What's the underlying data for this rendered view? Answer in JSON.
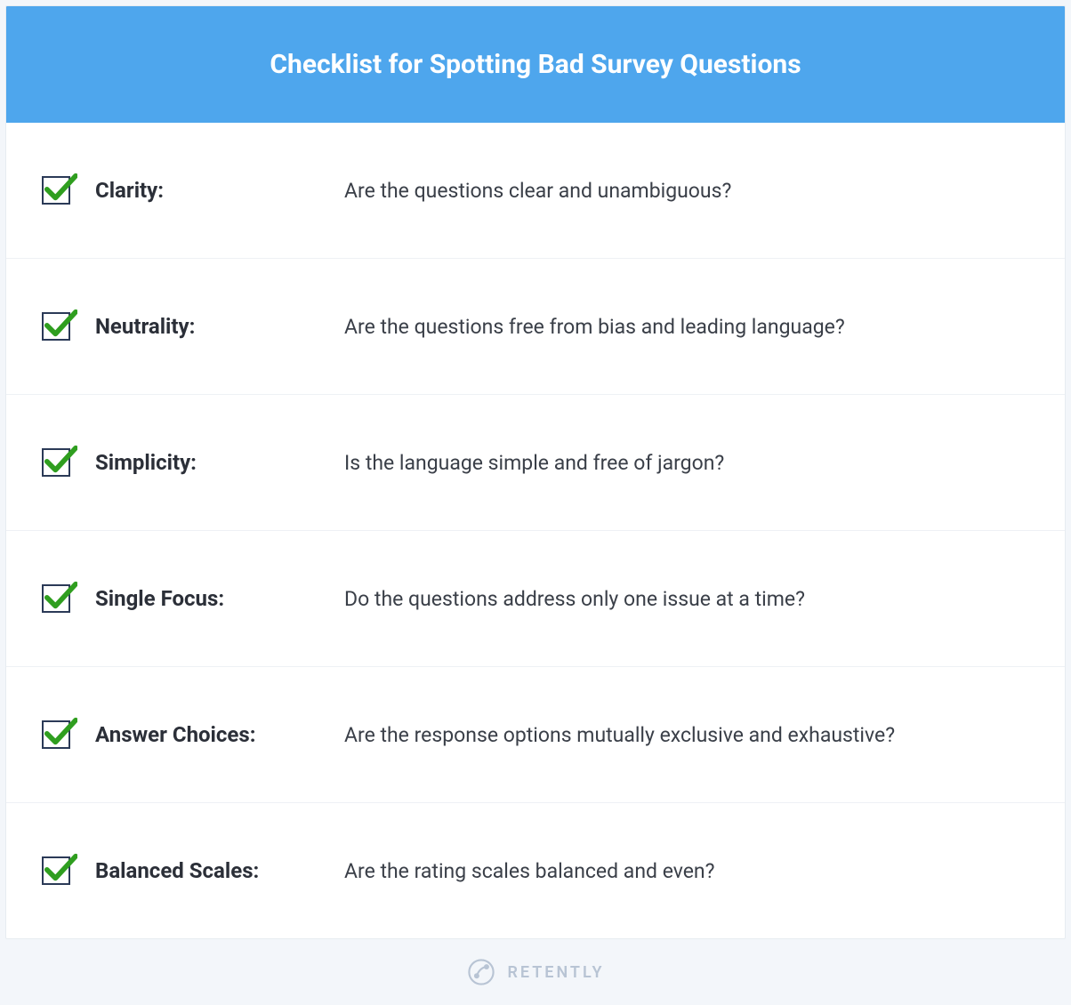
{
  "header": {
    "title": "Checklist for Spotting Bad Survey Questions"
  },
  "items": [
    {
      "label": "Clarity:",
      "description": "Are the questions clear and unambiguous?"
    },
    {
      "label": "Neutrality:",
      "description": "Are the questions free from bias and leading language?"
    },
    {
      "label": "Simplicity:",
      "description": "Is the language simple and free of jargon?"
    },
    {
      "label": "Single Focus:",
      "description": "Do the questions address only one issue at a time?"
    },
    {
      "label": "Answer Choices:",
      "description": "Are the response options mutually exclusive and exhaustive?"
    },
    {
      "label": "Balanced Scales:",
      "description": "Are the rating scales balanced and even?"
    }
  ],
  "footer": {
    "brand": "RETENTLY"
  },
  "colors": {
    "header_bg": "#4ea6ed",
    "check_mark": "#2f9e1f",
    "check_border": "#2b3a57"
  }
}
